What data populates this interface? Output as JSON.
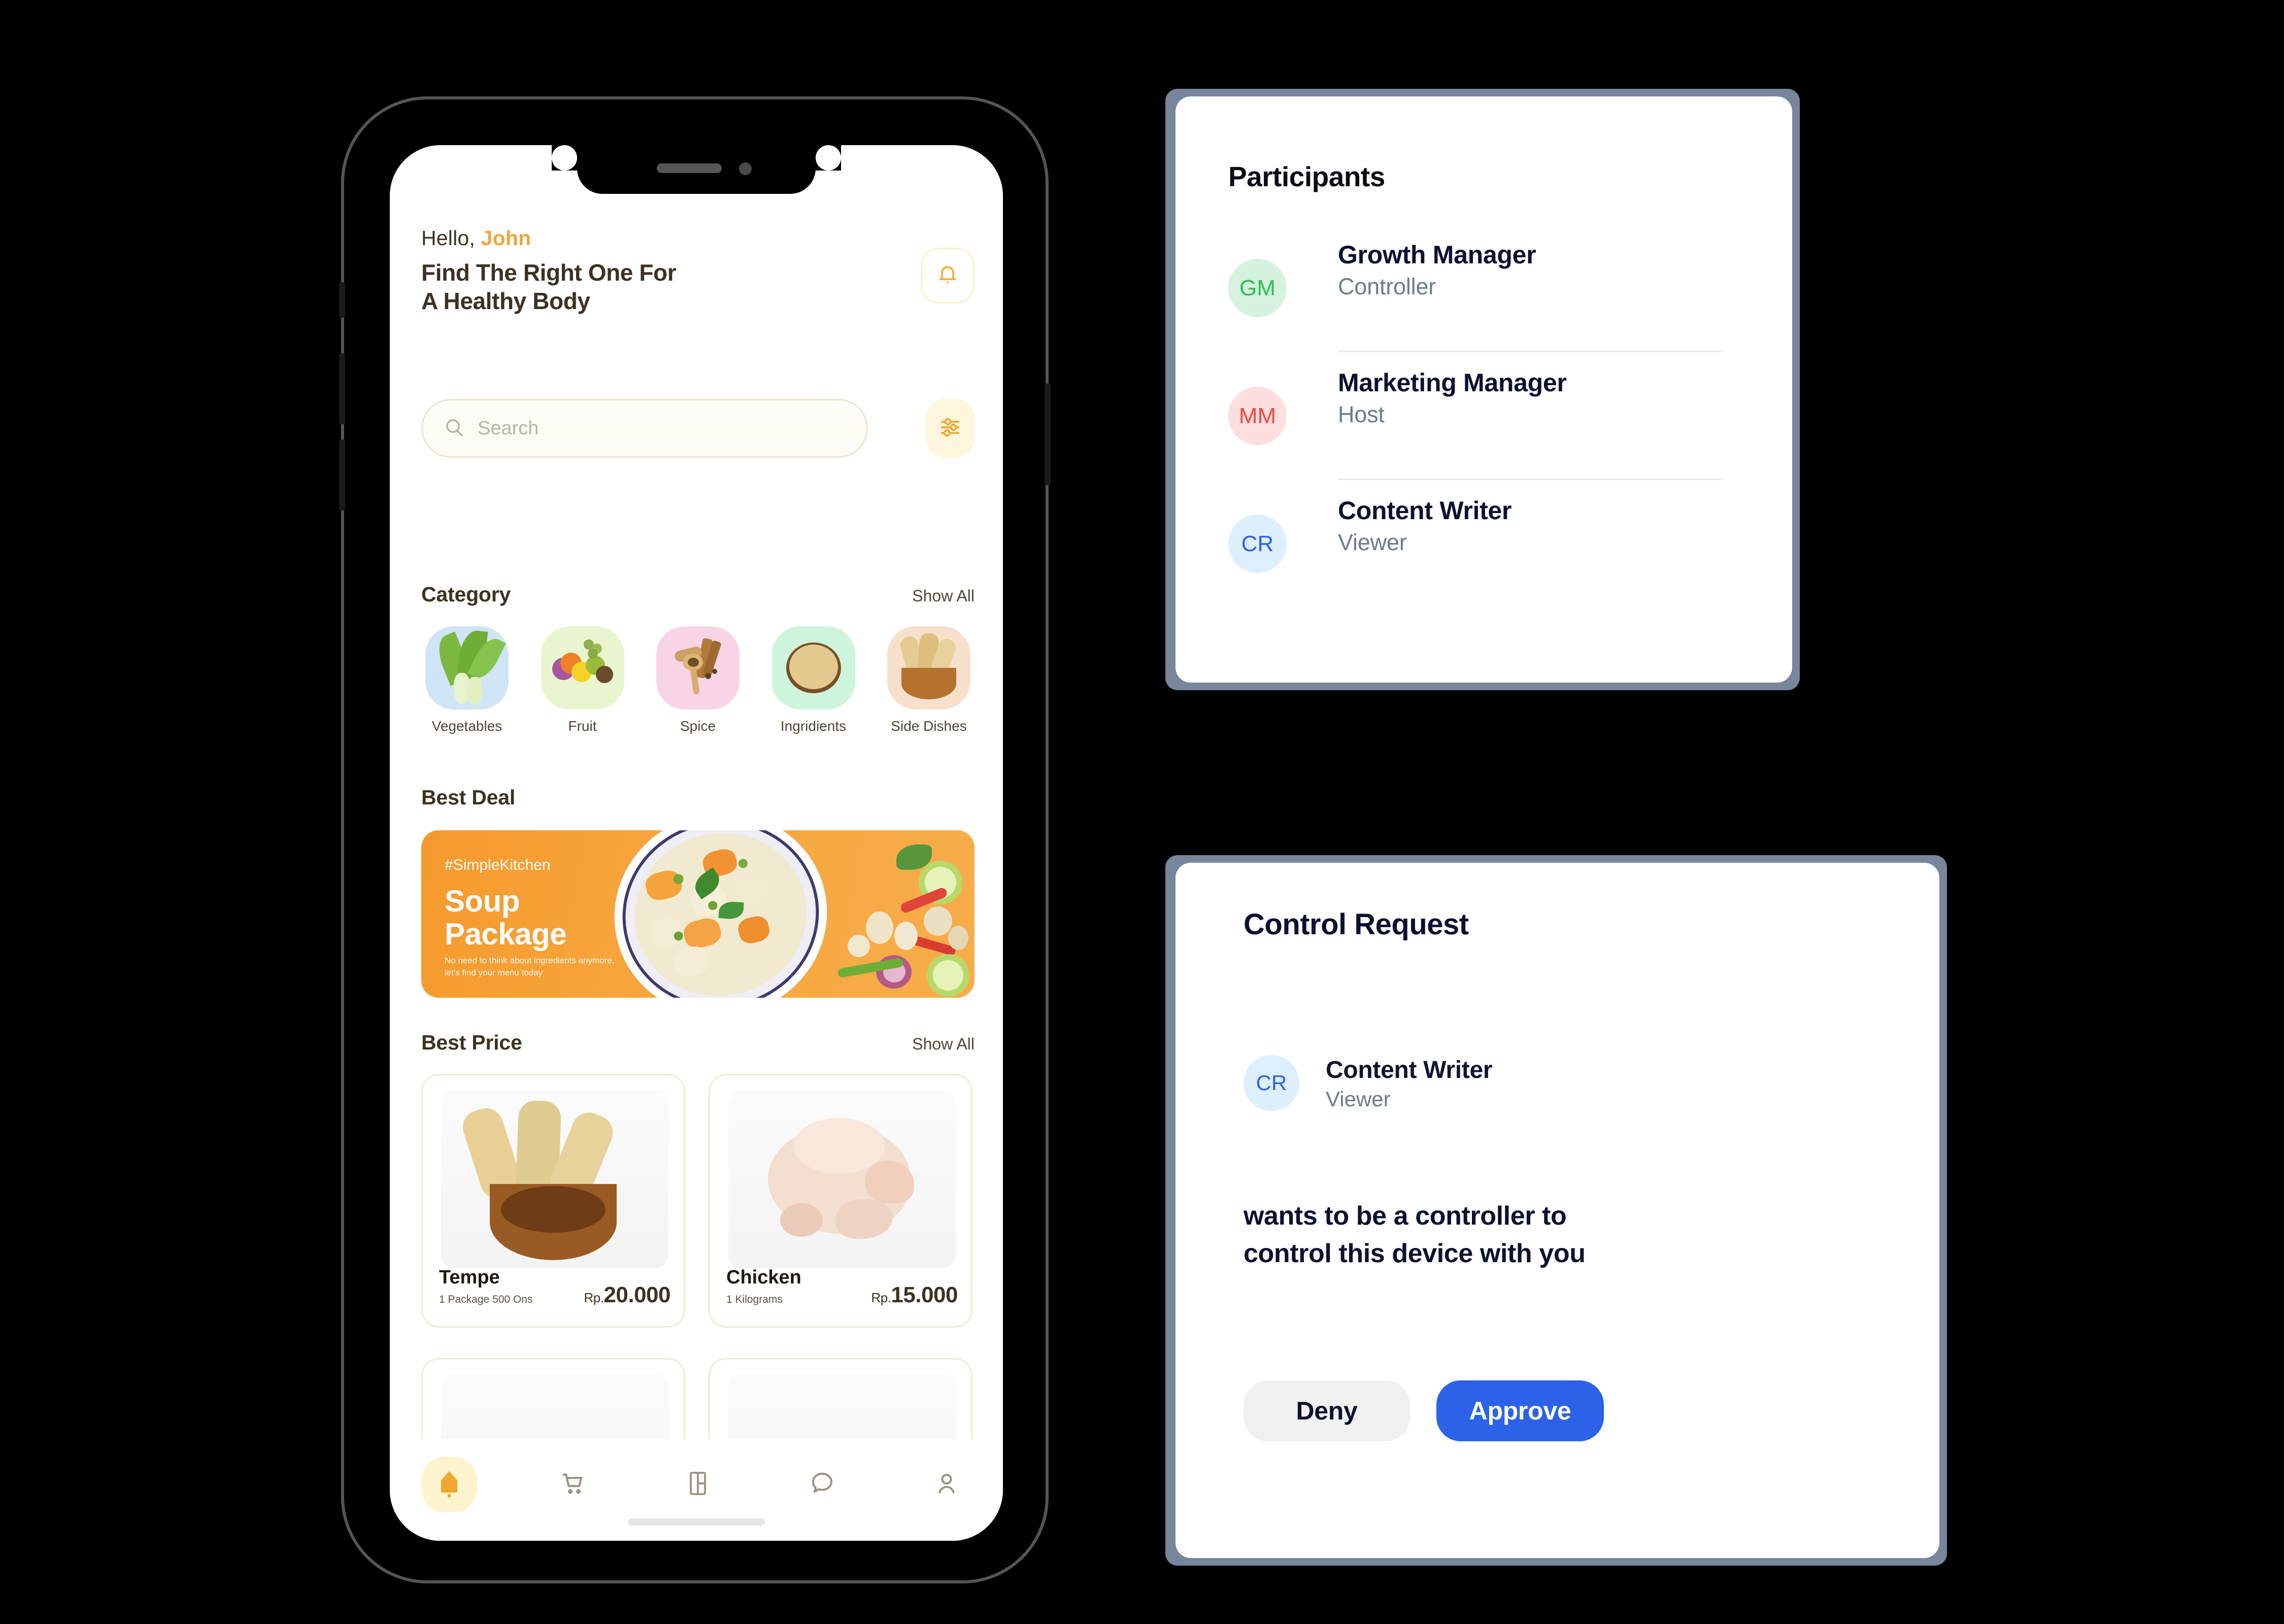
{
  "phone_app": {
    "greeting_prefix": "Hello, ",
    "greeting_name": "John",
    "headline_line1": "Find The Right One For",
    "headline_line2": "A Healthy Body",
    "bell_icon": "bell-icon",
    "search": {
      "placeholder": "Search",
      "icon": "search-icon"
    },
    "filter_icon": "sliders-icon",
    "category": {
      "title": "Category",
      "show_all": "Show All",
      "items": [
        {
          "label": "Vegetables",
          "bg": "#cfe4f5",
          "art": "pak-choi"
        },
        {
          "label": "Fruit",
          "bg": "#e9f5cf",
          "art": "mixed-fruit"
        },
        {
          "label": "Spice",
          "bg": "#f8d4e6",
          "art": "cinnamon-spoon"
        },
        {
          "label": "Ingridients",
          "bg": "#cdf5dc",
          "art": "grain-bowl"
        },
        {
          "label": "Side Dishes",
          "bg": "#f7e0cb",
          "art": "tempe-bowl"
        }
      ]
    },
    "best_deal": {
      "title": "Best Deal",
      "hashtag": "#SimpleKitchen",
      "name_line1": "Soup",
      "name_line2": "Package",
      "sub_line1": "No need to think about ingredients anymore,",
      "sub_line2": "let's find your menu today",
      "bg_color": "#f59a2e"
    },
    "best_price": {
      "title": "Best Price",
      "show_all": "Show All",
      "products": [
        {
          "name": "Tempe",
          "unit": "1 Package 500 Ons",
          "currency": "Rp.",
          "price": "20.000"
        },
        {
          "name": "Chicken",
          "unit": "1 Kilograms",
          "currency": "Rp.",
          "price": "15.000"
        }
      ]
    },
    "bottom_nav": [
      {
        "icon": "home-icon",
        "active": true
      },
      {
        "icon": "cart-icon",
        "active": false
      },
      {
        "icon": "layout-grid-icon",
        "active": false
      },
      {
        "icon": "chat-bubble-icon",
        "active": false
      },
      {
        "icon": "person-icon",
        "active": false
      }
    ]
  },
  "participants_card": {
    "title": "Participants",
    "rows": [
      {
        "initials": "GM",
        "name": "Growth Manager",
        "role": "Controller",
        "avatar_bg": "#d5f2de",
        "avatar_fg": "#2ec04f"
      },
      {
        "initials": "MM",
        "name": "Marketing Manager",
        "role": "Host",
        "avatar_bg": "#fcdede",
        "avatar_fg": "#f94444"
      },
      {
        "initials": "CR",
        "name": "Content Writer",
        "role": "Viewer",
        "avatar_bg": "#ddeeff",
        "avatar_fg": "#2b62e8"
      }
    ]
  },
  "control_request_card": {
    "title": "Control Request",
    "user": {
      "initials": "CR",
      "name": "Content Writer",
      "role": "Viewer",
      "avatar_bg": "#ddeeff",
      "avatar_fg": "#2b62e8"
    },
    "message_line1": "wants to be a controller to",
    "message_line2": "control this device with you",
    "deny_label": "Deny",
    "approve_label": "Approve",
    "approve_color": "#2b62e8",
    "deny_color": "#f0f0f0"
  }
}
